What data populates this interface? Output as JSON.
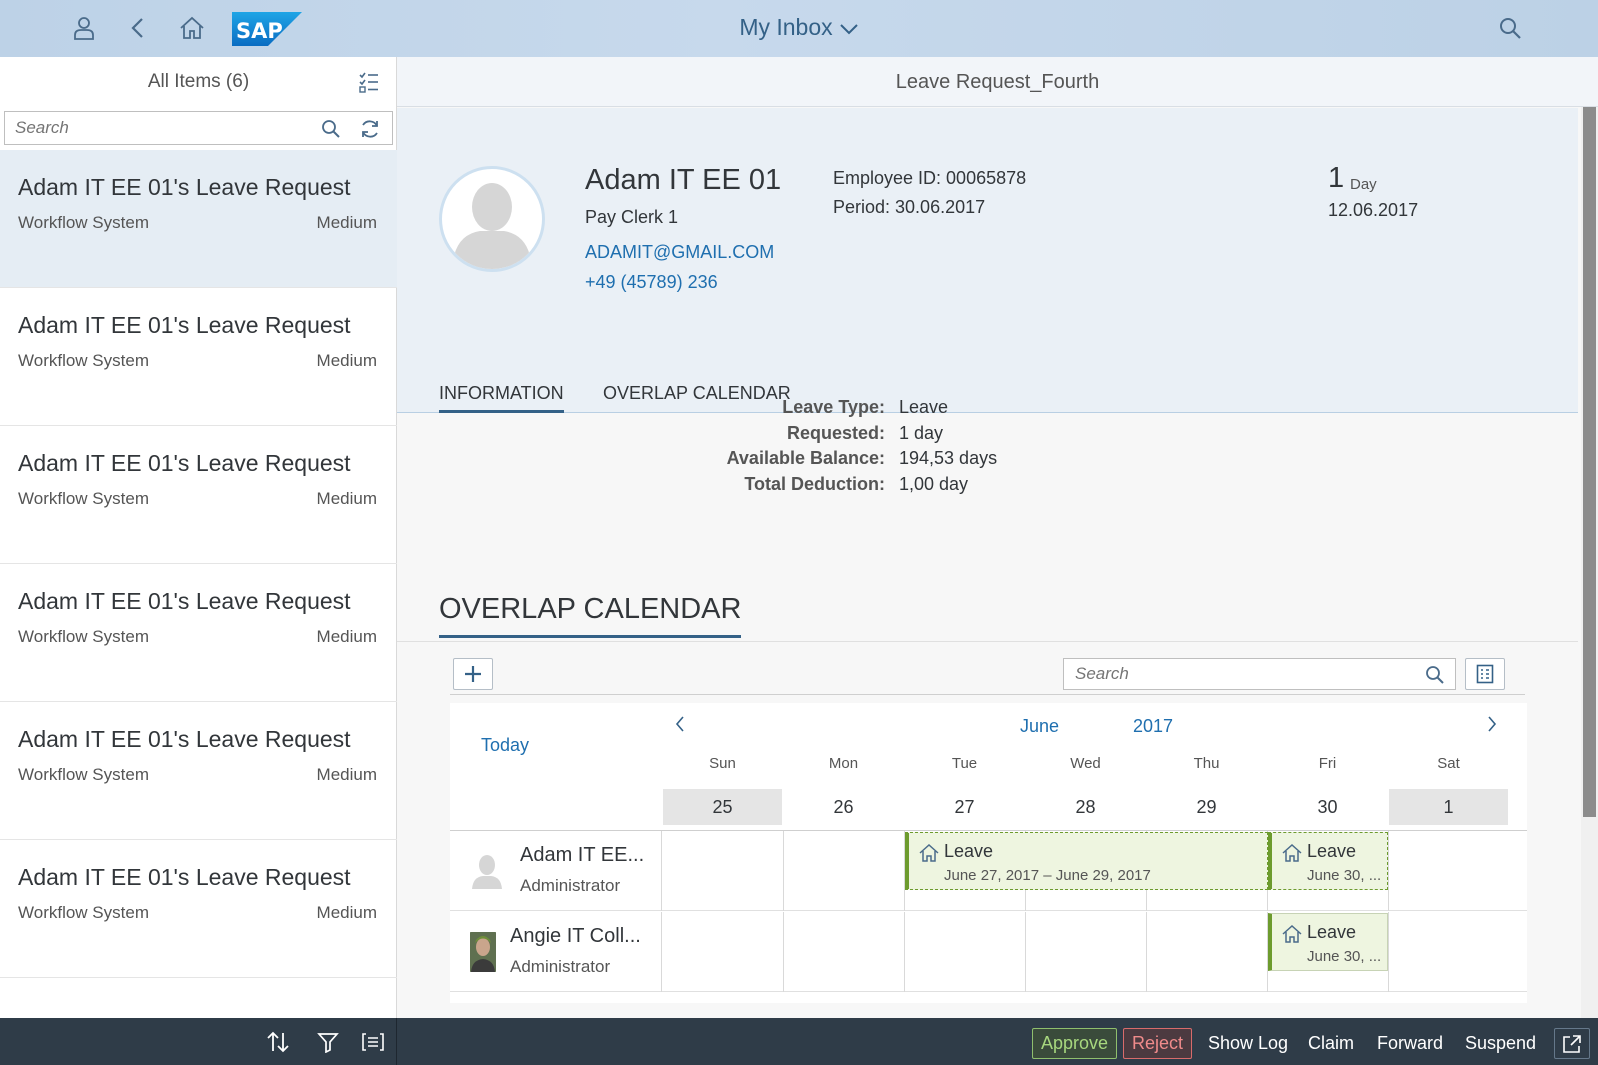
{
  "shell": {
    "title": "My Inbox",
    "logo_text": "SAP",
    "icons": [
      "user-icon",
      "back-icon",
      "home-icon",
      "search-icon"
    ]
  },
  "master": {
    "title": "All Items (6)",
    "search_placeholder": "Search",
    "items": [
      {
        "title": "Adam IT EE 01's Leave Request",
        "source": "Workflow System",
        "priority": "Medium"
      },
      {
        "title": "Adam IT EE 01's Leave Request",
        "source": "Workflow System",
        "priority": "Medium"
      },
      {
        "title": "Adam IT EE 01's Leave Request",
        "source": "Workflow System",
        "priority": "Medium"
      },
      {
        "title": "Adam IT EE 01's Leave Request",
        "source": "Workflow System",
        "priority": "Medium"
      },
      {
        "title": "Adam IT EE 01's Leave Request",
        "source": "Workflow System",
        "priority": "Medium"
      },
      {
        "title": "Adam IT EE 01's Leave Request",
        "source": "Workflow System",
        "priority": "Medium"
      }
    ]
  },
  "detail": {
    "title": "Leave Request_Fourth",
    "header": {
      "name": "Adam IT EE 01",
      "role": "Pay Clerk 1",
      "email": "ADAMIT@GMAIL.COM",
      "phone": "+49 (45789) 236",
      "employee_id": "Employee ID: 00065878",
      "period": "Period: 30.06.2017",
      "number": "1",
      "unit": "Day",
      "date": "12.06.2017"
    },
    "tabs": {
      "information": "INFORMATION",
      "overlap": "OVERLAP CALENDAR"
    },
    "info": {
      "leave_type_label": "Leave Type:",
      "leave_type_value": "Leave",
      "requested_label": "Requested:",
      "requested_value": "1 day",
      "balance_label": "Available Balance:",
      "balance_value": "194,53 days",
      "deduction_label": "Total Deduction:",
      "deduction_value": "1,00 day"
    },
    "overlap_section_title": "OVERLAP CALENDAR"
  },
  "calendar": {
    "search_placeholder": "Search",
    "today_label": "Today",
    "month": "June",
    "year": "2017",
    "days": [
      {
        "name": "Sun",
        "num": "25"
      },
      {
        "name": "Mon",
        "num": "26"
      },
      {
        "name": "Tue",
        "num": "27"
      },
      {
        "name": "Wed",
        "num": "28"
      },
      {
        "name": "Thu",
        "num": "29"
      },
      {
        "name": "Fri",
        "num": "30"
      },
      {
        "name": "Sat",
        "num": "1"
      }
    ],
    "rows": [
      {
        "name": "Adam IT EE...",
        "role": "Administrator",
        "appointments": [
          {
            "title": "Leave",
            "text": "June 27, 2017 – June 29, 2017"
          },
          {
            "title": "Leave",
            "text": "June 30, ..."
          }
        ]
      },
      {
        "name": "Angie IT Coll...",
        "role": "Administrator",
        "appointments": [
          {
            "title": "Leave",
            "text": "June 30, ..."
          }
        ]
      }
    ]
  },
  "footer": {
    "approve": "Approve",
    "reject": "Reject",
    "show_log": "Show Log",
    "claim": "Claim",
    "forward": "Forward",
    "suspend": "Suspend"
  },
  "colors": {
    "shell_bg": "#c3d6e9",
    "accent": "#346187",
    "link": "#1f6faf",
    "footer_bg": "#2f3c48",
    "approve": "#a7d77e",
    "reject": "#f08b8b",
    "leave_appointment": "#6d9b2e"
  }
}
